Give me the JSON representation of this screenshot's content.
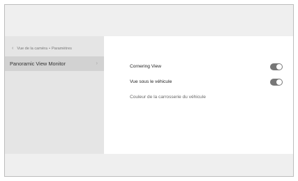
{
  "breadcrumb": {
    "back_glyph": "‹",
    "parent": "Vue de la caméra",
    "separator": "•",
    "current": "Paramètres"
  },
  "sidebar": {
    "items": [
      {
        "label": "Panoramic View Monitor",
        "chevron": "›",
        "selected": true
      }
    ]
  },
  "settings": [
    {
      "label": "Cornering View",
      "toggle": true,
      "on": true
    },
    {
      "label": "Vue sous le véhicule",
      "toggle": true,
      "on": true
    },
    {
      "label": "Couleur de la carrosserie du véhicule",
      "toggle": false
    }
  ],
  "colors": {
    "selected_bg": "#d2d2d2",
    "toggle_on": "#777777",
    "panel": "#ffffff",
    "chrome": "#efefef"
  }
}
